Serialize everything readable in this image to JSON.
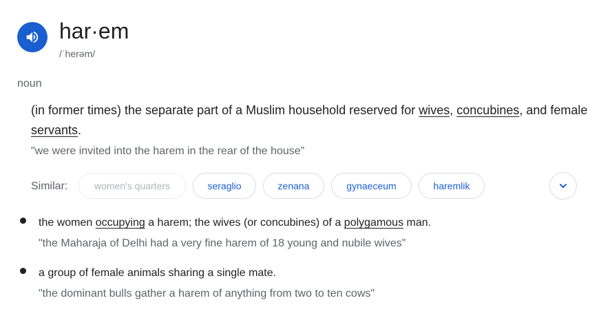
{
  "entry": {
    "headword": "har·em",
    "pronunciation": "/ˈherəm/",
    "part_of_speech": "noun",
    "audio_icon": "speaker-icon"
  },
  "definitions": [
    {
      "parts": [
        {
          "text": "(in former times) the separate part of a Muslim household reserved for ",
          "link": false
        },
        {
          "text": "wives",
          "link": true
        },
        {
          "text": ", ",
          "link": false
        },
        {
          "text": "concubines",
          "link": true
        },
        {
          "text": ", and female ",
          "link": false
        },
        {
          "text": "servants",
          "link": true
        },
        {
          "text": ".",
          "link": false
        }
      ],
      "example": "\"we were invited into the harem in the rear of the house\""
    }
  ],
  "similar": {
    "label": "Similar:",
    "chips": [
      "women's quarters",
      "seraglio",
      "zenana",
      "gynaeceum",
      "haremlik"
    ],
    "expand_icon": "chevron-down-icon"
  },
  "senses": [
    {
      "parts": [
        {
          "text": "the women ",
          "link": false
        },
        {
          "text": "occupying",
          "link": true
        },
        {
          "text": " a harem; the wives (or concubines) of a ",
          "link": false
        },
        {
          "text": "polygamous",
          "link": true
        },
        {
          "text": " man.",
          "link": false
        }
      ],
      "example": "\"the Maharaja of Delhi had a very fine harem of 18 young and nubile wives\""
    },
    {
      "parts": [
        {
          "text": "a group of female animals sharing a single mate.",
          "link": false
        }
      ],
      "example": "\"the dominant bulls gather a harem of anything from two to ten cows\""
    }
  ],
  "colors": {
    "accent": "#1a5fd0",
    "text": "#202124",
    "muted": "#5f6368",
    "chip_border": "#dadce0"
  }
}
